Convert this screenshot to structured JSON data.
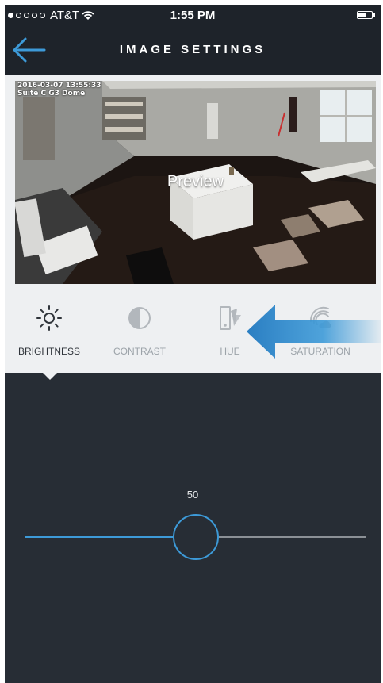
{
  "status_bar": {
    "signal_dots": 1,
    "carrier": "AT&T",
    "time": "1:55 PM",
    "battery_level": 0.6
  },
  "nav": {
    "title": "IMAGE SETTINGS",
    "back_icon": "arrow-left-icon"
  },
  "preview": {
    "label": "Preview",
    "camera_timestamp": "2016-03-07 13:55:33",
    "camera_name": "Suite C G3 Dome"
  },
  "tabs": [
    {
      "label": "BRIGHTNESS",
      "icon": "sun-icon",
      "active": true
    },
    {
      "label": "CONTRAST",
      "icon": "contrast-icon",
      "active": false
    },
    {
      "label": "HUE",
      "icon": "hue-icon",
      "active": false
    },
    {
      "label": "SATURATION",
      "icon": "saturation-icon",
      "active": false
    }
  ],
  "slider": {
    "value": "50",
    "min": 0,
    "max": 100
  },
  "colors": {
    "accent": "#3d9ad8",
    "bar_dark": "#1e232a",
    "panel": "#272d35",
    "tab_bg": "#eef0f2"
  }
}
